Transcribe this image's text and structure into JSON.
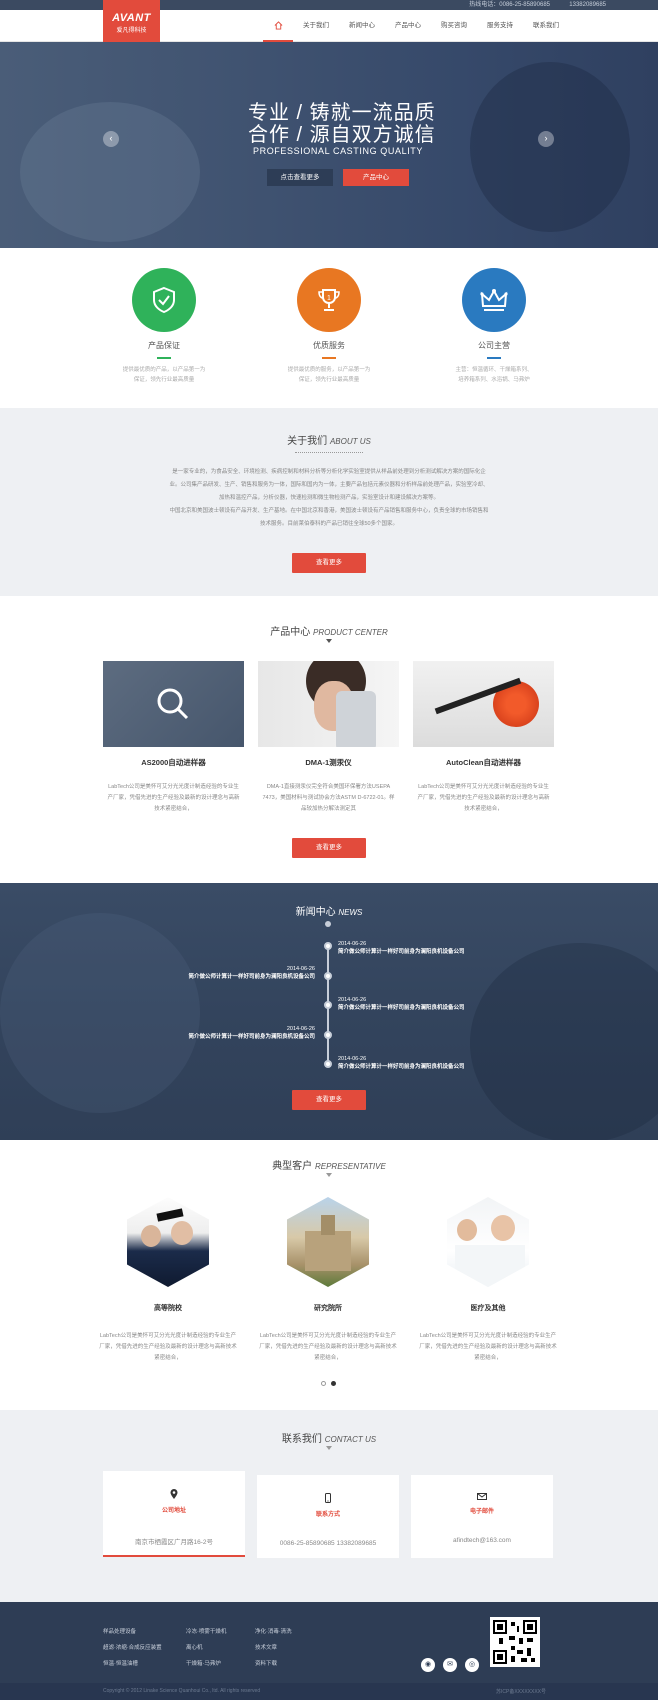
{
  "topbar": {
    "phone_label": "热线电话：",
    "phone": "0086-25-85890685",
    "mobile": "13382089685"
  },
  "logo": {
    "brand": "AVANT",
    "sub": "爱凡得科技"
  },
  "nav": {
    "home_icon": "home-icon",
    "items": [
      "关于我们",
      "新闻中心",
      "产品中心",
      "购买咨询",
      "服务支持",
      "联系我们"
    ]
  },
  "hero": {
    "line1": "专业 / 铸就一流品质",
    "line2": "合作 / 源自双方诚信",
    "english": "PROFESSIONAL CASTING QUALITY",
    "btn_more": "点击查看更多",
    "btn_products": "产品中心",
    "prev": "‹",
    "next": "›"
  },
  "features": [
    {
      "title": "产品保证",
      "desc1": "提供最优质的产品，以产品第一为",
      "desc2": "保证，领先行业最高质量",
      "color": "#2fb25a",
      "icon": "shield-check-icon"
    },
    {
      "title": "优质服务",
      "desc1": "提供最优质的服务，以产品第一为",
      "desc2": "保证，领先行业最高质量",
      "color": "#e87722",
      "icon": "trophy-icon"
    },
    {
      "title": "公司主营",
      "desc1": "主营：恒温循环、干燥箱系列、",
      "desc2": "培养箱系列、水浴锅、马弗炉",
      "color": "#2a7ac0",
      "icon": "crown-icon"
    }
  ],
  "about": {
    "title": "关于我们",
    "title_en": "ABOUT US",
    "p1": "是一家专业的，为食品安全、环境检测、疾病控制和材料分析等分析化学实验室提供从样品前处理到分析测试解决方案的国际化企业。公司集产品研发、生产、销售和服务为一体，国际和国内为一体，主要产品包括元素仪器和分析样品前处理产品，实验室冷却、加热和温控产品，分析仪器，快速检测和微生物检测产品，实验室设计和建设解决方案等。",
    "p2": "中国北京和美国波士顿设有产品开发、生产基地。在中国北京和香港，美国波士顿设有产品销售和服务中心，负责全球的市场销售和技术服务。目前莱伯泰科的产品已销往全球50多个国家。",
    "btn": "查看更多"
  },
  "products": {
    "title": "产品中心",
    "title_en": "PRODUCT CENTER",
    "items": [
      {
        "name": "AS2000自动进样器",
        "desc": "LabTech公司是美怀可艾分光光度计制造经验的专业生产厂家，凭借先进的生产经验及最新的设计理念与高新技术紧密结合，"
      },
      {
        "name": "DMA-1测汞仪",
        "desc": "DMA-1直接测汞仪完全符合美国环保署方法USEPA 7473，美国材料与测试协会方法ASTM D-6722-01。样品较加热分解法测定其"
      },
      {
        "name": "AutoClean自动进样器",
        "desc": "LabTech公司是美怀可艾分光光度计制造经验的专业生产厂家，凭借先进的生产经验及最新的设计理念与高新技术紧密结合，"
      }
    ],
    "btn": "查看更多"
  },
  "news": {
    "title": "新闻中心",
    "title_en": "NEWS",
    "items": [
      {
        "date": "2014-06-26",
        "title": "简介做公师计算计一样好司前身为澜阳良机设备公司"
      },
      {
        "date": "2014-06-26",
        "title": "简介做公师计算计一样好司前身为澜阳良机设备公司"
      },
      {
        "date": "2014-06-26",
        "title": "简介做公师计算计一样好司前身为澜阳良机设备公司"
      },
      {
        "date": "2014-06-26",
        "title": "简介做公师计算计一样好司前身为澜阳良机设备公司"
      },
      {
        "date": "2014-06-26",
        "title": "简介做公师计算计一样好司前身为澜阳良机设备公司"
      }
    ],
    "btn": "查看更多"
  },
  "clients": {
    "title": "典型客户",
    "title_en": "REPRESENTATIVE",
    "items": [
      {
        "name": "高等院校",
        "desc": "LabTech公司是美怀可艾分光光度计制造经验的专业生产厂家，凭借先进的生产经验及最新的设计理念与高新技术紧密结合，"
      },
      {
        "name": "研究院所",
        "desc": "LabTech公司是美怀可艾分光光度计制造经验的专业生产厂家，凭借先进的生产经验及最新的设计理念与高新技术紧密结合，"
      },
      {
        "name": "医疗及其他",
        "desc": "LabTech公司是美怀可艾分光光度计制造经验的专业生产厂家，凭借先进的生产经验及最新的设计理念与高新技术紧密结合，"
      }
    ]
  },
  "contact": {
    "title": "联系我们",
    "title_en": "CONTACT US",
    "cards": [
      {
        "icon": "location-pin-icon",
        "label": "公司地址",
        "value": "南京市栖霞区广月路16-2号"
      },
      {
        "icon": "phone-icon",
        "label": "联系方式",
        "value": "0086-25-85890685  13382089685"
      },
      {
        "icon": "mail-icon",
        "label": "电子邮件",
        "value": "afindtech@163.com"
      }
    ]
  },
  "footer": {
    "col1": [
      "样品处理设备",
      "超滤·浓缩·合成反应装置",
      "恒温·恒温油槽"
    ],
    "col2": [
      "冷冻·喷雾干燥机",
      "离心机",
      "干燥箱·马弗炉"
    ],
    "col3": [
      "净化·消毒·清洗",
      "技术文章",
      "资料下载"
    ],
    "copyright": "Copyright © 2012 Linake Science Quanhoui Co., ltd. All rights reserved",
    "icp": "苏ICP备XXXXXXXX号"
  }
}
